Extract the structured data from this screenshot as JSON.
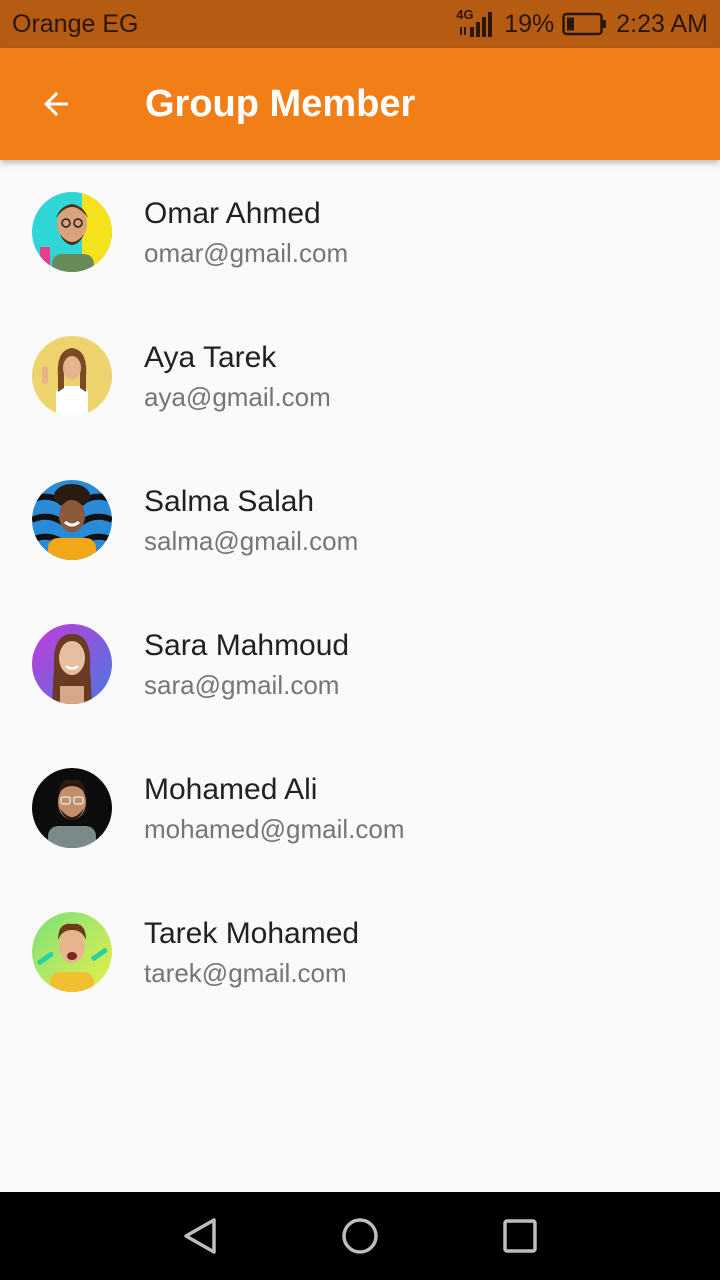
{
  "status_bar": {
    "carrier": "Orange EG",
    "network": "4G",
    "battery": "19%",
    "time": "2:23 AM"
  },
  "app_bar": {
    "title": "Group Member",
    "back_icon": "arrow-back-icon"
  },
  "members": [
    {
      "name": "Omar Ahmed",
      "email": "omar@gmail.com"
    },
    {
      "name": "Aya Tarek",
      "email": "aya@gmail.com"
    },
    {
      "name": "Salma Salah",
      "email": "salma@gmail.com"
    },
    {
      "name": "Sara Mahmoud",
      "email": "sara@gmail.com"
    },
    {
      "name": "Mohamed Ali",
      "email": "mohamed@gmail.com"
    },
    {
      "name": "Tarek Mohamed",
      "email": "tarek@gmail.com"
    }
  ],
  "nav_bar": {
    "icons": [
      "back-triangle-icon",
      "home-circle-icon",
      "recents-square-icon"
    ]
  },
  "colors": {
    "status_bar": "#b65c12",
    "app_bar": "#f27e18",
    "background": "#fafafa"
  }
}
